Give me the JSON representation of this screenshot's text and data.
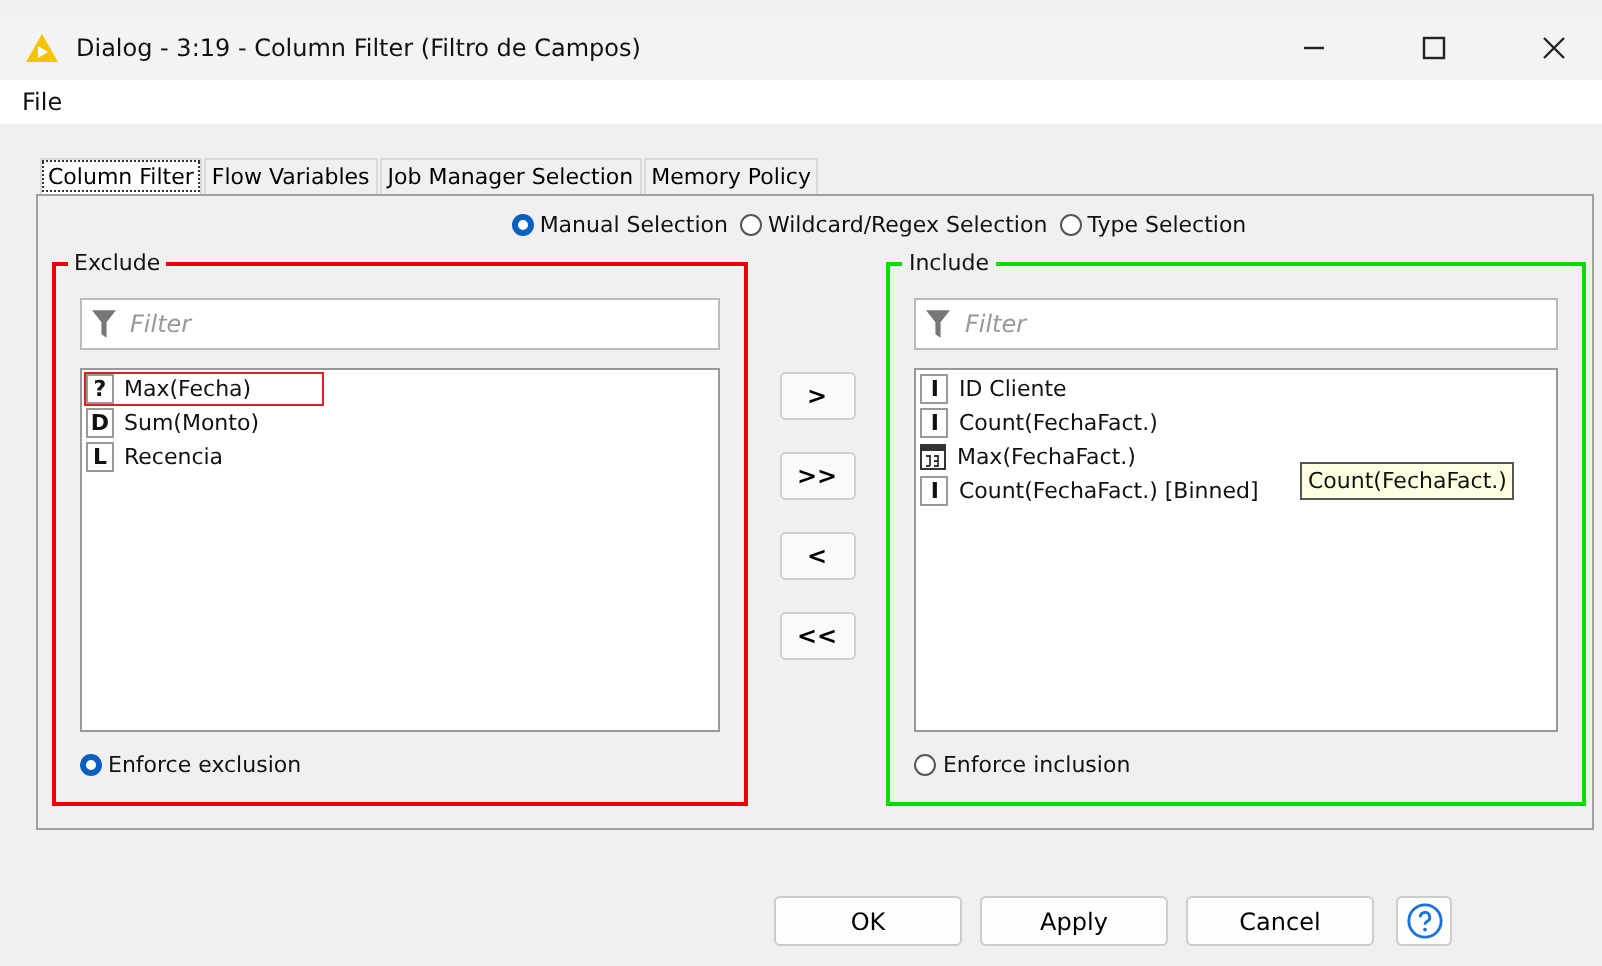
{
  "window": {
    "title": "Dialog - 3:19 - Column Filter (Filtro de Campos)"
  },
  "menu": [
    "File"
  ],
  "tabs": [
    {
      "label": "Column Filter",
      "selected": true
    },
    {
      "label": "Flow Variables",
      "selected": false
    },
    {
      "label": "Job Manager Selection",
      "selected": false
    },
    {
      "label": "Memory Policy",
      "selected": false
    }
  ],
  "mode": [
    {
      "label": "Manual Selection",
      "selected": true
    },
    {
      "label": "Wildcard/Regex Selection",
      "selected": false
    },
    {
      "label": "Type Selection",
      "selected": false
    }
  ],
  "exclude": {
    "title": "Exclude",
    "color": "#ee0000",
    "filter": {
      "placeholder": "Filter"
    },
    "items": [
      {
        "kind": "letter",
        "type_mark": "?",
        "name": "Max(Fecha)",
        "selected": true
      },
      {
        "kind": "letter",
        "type_mark": "D",
        "name": "Sum(Monto)",
        "selected": false
      },
      {
        "kind": "letter",
        "type_mark": "L",
        "name": "Recencia",
        "selected": false
      }
    ],
    "enforce": {
      "label": "Enforce exclusion",
      "selected": true
    }
  },
  "move_buttons": [
    ">",
    ">>",
    "<",
    "<<"
  ],
  "include": {
    "title": "Include",
    "color": "#00dd00",
    "filter": {
      "placeholder": "Filter"
    },
    "items": [
      {
        "kind": "letter",
        "type_mark": "I",
        "name": "ID Cliente",
        "selected": false
      },
      {
        "kind": "letter",
        "type_mark": "I",
        "name": "Count(FechaFact.)",
        "selected": false
      },
      {
        "kind": "date",
        "name": "Max(FechaFact.)",
        "selected": false
      },
      {
        "kind": "letter",
        "type_mark": "I",
        "name": "Count(FechaFact.) [Binned]",
        "selected": false
      }
    ],
    "enforce": {
      "label": "Enforce inclusion",
      "selected": false
    }
  },
  "tooltip": "Count(FechaFact.)",
  "buttons": [
    "OK",
    "Apply",
    "Cancel"
  ]
}
